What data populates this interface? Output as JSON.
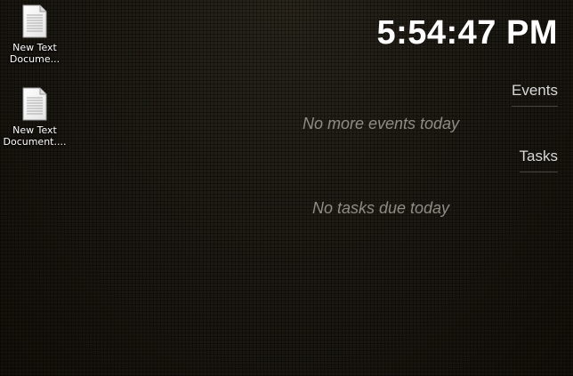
{
  "desktop": {
    "icons": [
      {
        "label": "New Text Docume...",
        "icon": "text-document-icon"
      },
      {
        "label": "New Text Document....",
        "icon": "text-document-icon"
      }
    ]
  },
  "widget": {
    "time": "5:54:47 PM",
    "events": {
      "header": "Events",
      "empty_message": "No more events today"
    },
    "tasks": {
      "header": "Tasks",
      "empty_message": "No tasks due today"
    }
  },
  "colors": {
    "background": "#181610",
    "clock_text": "#ffffff",
    "header_text": "#d8d8d8",
    "empty_text": "#8f8c86"
  }
}
